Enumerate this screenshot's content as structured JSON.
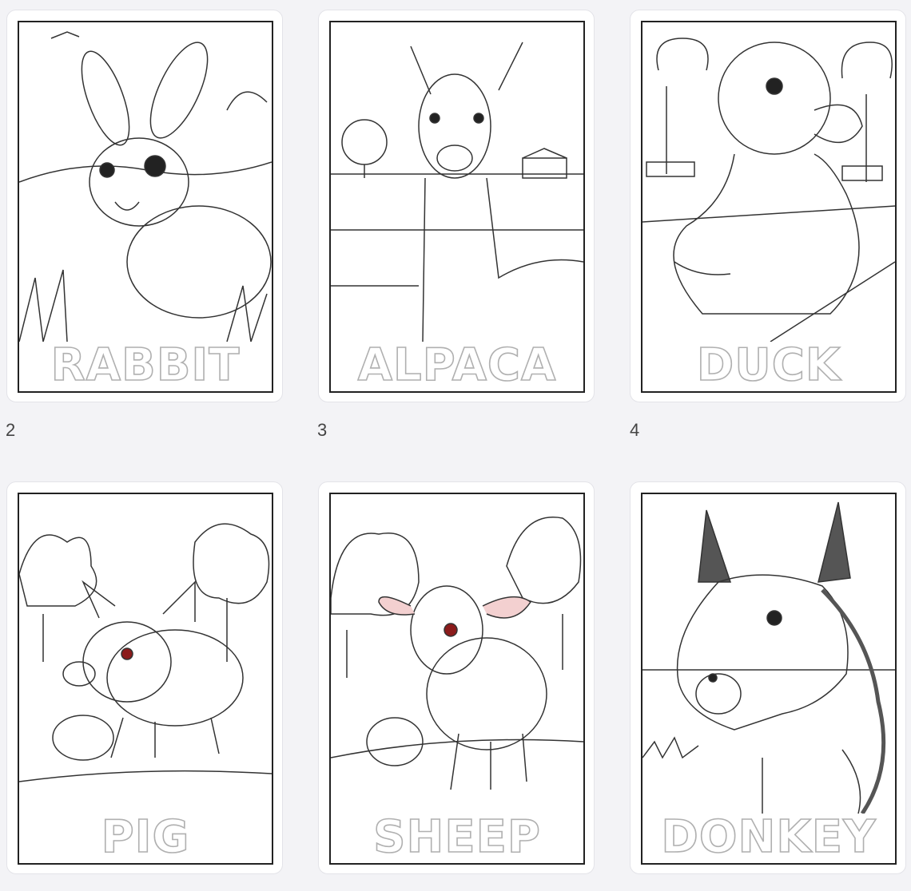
{
  "pages": [
    {
      "word": "RABBIT",
      "icon": "rabbit-illustration"
    },
    {
      "word": "ALPACA",
      "icon": "alpaca-illustration"
    },
    {
      "word": "DUCK",
      "icon": "duck-illustration"
    },
    {
      "word": "PIG",
      "icon": "pig-illustration"
    },
    {
      "word": "SHEEP",
      "icon": "sheep-illustration"
    },
    {
      "word": "DONKEY",
      "icon": "donkey-illustration"
    }
  ],
  "page_numbers": [
    "2",
    "3",
    "4"
  ],
  "colors": {
    "background": "#f3f3f6",
    "card": "#ffffff",
    "outline_text": "#b0b0b0",
    "frame": "#222222"
  }
}
